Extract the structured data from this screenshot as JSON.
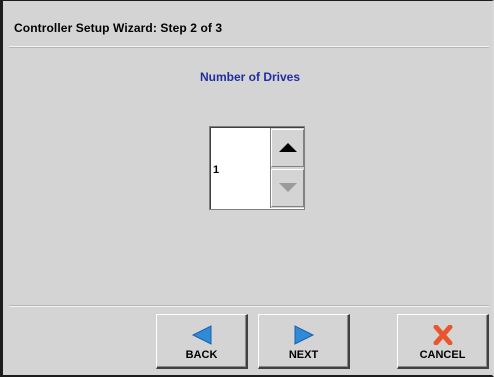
{
  "window": {
    "title": "Controller Setup Wizard:  Step 2 of 3"
  },
  "main": {
    "heading": "Number of Drives",
    "drives_value": "1"
  },
  "footer": {
    "back_label": "BACK",
    "next_label": "NEXT",
    "cancel_label": "CANCEL"
  },
  "icons": {
    "back": "left-arrow-icon",
    "next": "right-arrow-icon",
    "cancel": "x-icon",
    "spin_up": "up-triangle-icon",
    "spin_down": "down-triangle-icon"
  },
  "colors": {
    "heading": "#1f2ea0",
    "arrow_blue": "#2f8bd8",
    "cancel_red": "#e8552e",
    "background": "#d4d4d4"
  }
}
